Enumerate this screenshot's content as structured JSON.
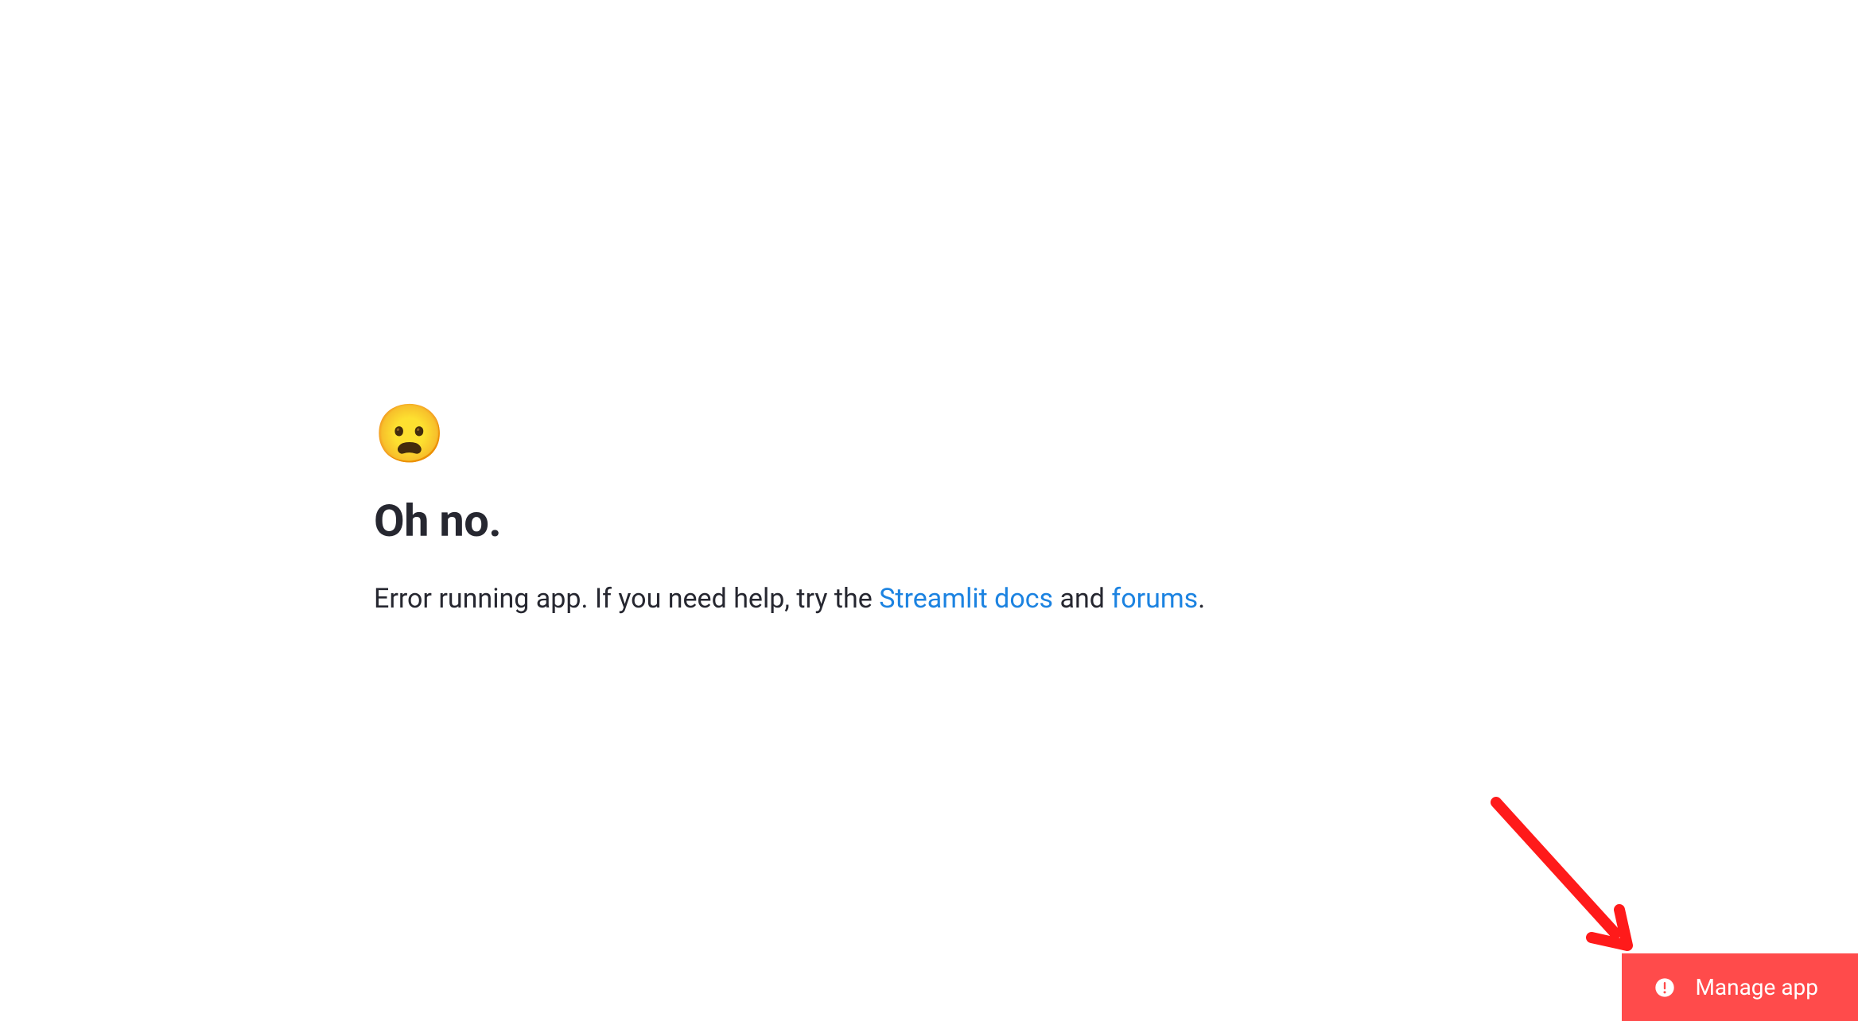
{
  "error": {
    "emoji": "😦",
    "heading": "Oh no.",
    "message_prefix": "Error running app. If you need help, try the ",
    "link_docs": "Streamlit docs",
    "message_mid": " and ",
    "link_forums": "forums",
    "message_suffix": "."
  },
  "footer": {
    "manage_label": "Manage app"
  }
}
